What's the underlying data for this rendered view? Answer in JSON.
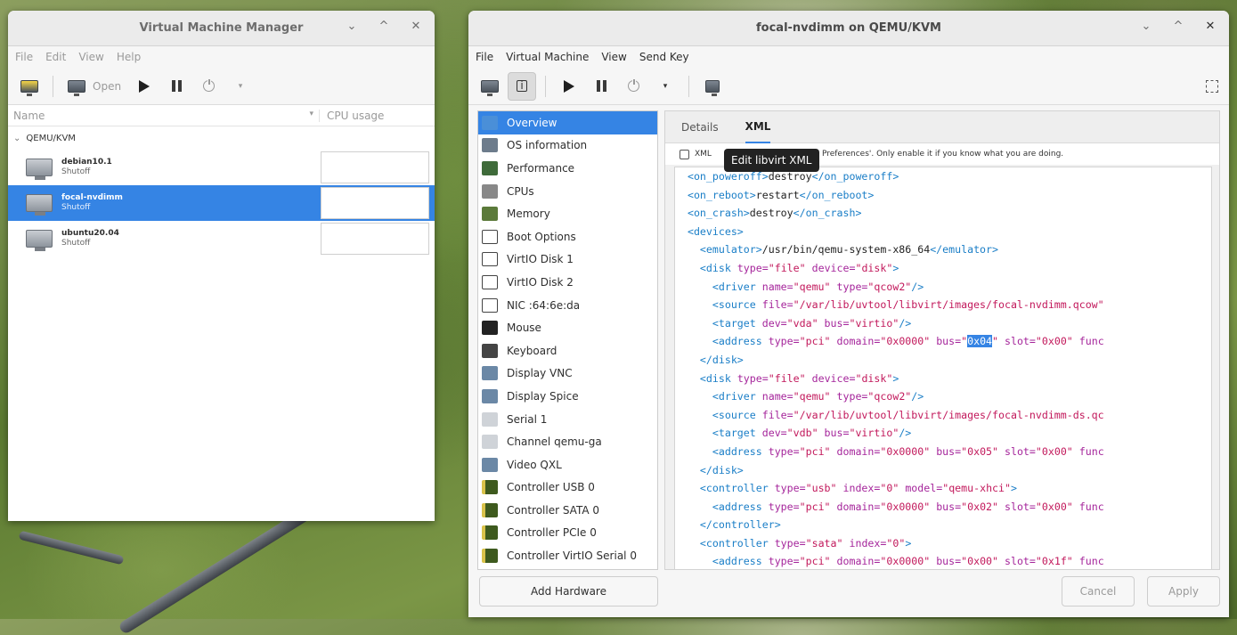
{
  "manager": {
    "title": "Virtual Machine Manager",
    "menu": [
      "File",
      "Edit",
      "View",
      "Help"
    ],
    "toolbar": {
      "open_label": "Open"
    },
    "columns": {
      "name": "Name",
      "cpu": "CPU usage"
    },
    "group": "QEMU/KVM",
    "vms": [
      {
        "name": "debian10.1",
        "state": "Shutoff"
      },
      {
        "name": "focal-nvdimm",
        "state": "Shutoff"
      },
      {
        "name": "ubuntu20.04",
        "state": "Shutoff"
      }
    ]
  },
  "vmwindow": {
    "title": "focal-nvdimm on QEMU/KVM",
    "menu": [
      "File",
      "Virtual Machine",
      "View",
      "Send Key"
    ],
    "sidebar": [
      {
        "label": "Overview",
        "icon": "overview-icon"
      },
      {
        "label": "OS information",
        "icon": "os-icon"
      },
      {
        "label": "Performance",
        "icon": "performance-icon"
      },
      {
        "label": "CPUs",
        "icon": "cpu-icon"
      },
      {
        "label": "Memory",
        "icon": "memory-icon"
      },
      {
        "label": "Boot Options",
        "icon": "boot-icon"
      },
      {
        "label": "VirtIO Disk 1",
        "icon": "disk-icon"
      },
      {
        "label": "VirtIO Disk 2",
        "icon": "disk-icon"
      },
      {
        "label": "NIC :64:6e:da",
        "icon": "nic-icon"
      },
      {
        "label": "Mouse",
        "icon": "mouse-icon"
      },
      {
        "label": "Keyboard",
        "icon": "keyboard-icon"
      },
      {
        "label": "Display VNC",
        "icon": "display-icon"
      },
      {
        "label": "Display Spice",
        "icon": "display-icon"
      },
      {
        "label": "Serial 1",
        "icon": "serial-icon"
      },
      {
        "label": "Channel qemu-ga",
        "icon": "channel-icon"
      },
      {
        "label": "Video QXL",
        "icon": "video-icon"
      },
      {
        "label": "Controller USB 0",
        "icon": "controller-icon"
      },
      {
        "label": "Controller SATA 0",
        "icon": "controller-icon"
      },
      {
        "label": "Controller PCIe 0",
        "icon": "controller-icon"
      },
      {
        "label": "Controller VirtIO Serial 0",
        "icon": "controller-icon"
      }
    ],
    "add_hardware": "Add Hardware",
    "tabs": {
      "details": "Details",
      "xml": "XML"
    },
    "xml_note": {
      "prefix": "XML",
      "suffix": "Preferences'. Only enable it if you know what you are doing."
    },
    "tooltip": "Edit libvirt XML",
    "xml_lines": [
      [
        [
          "tag",
          "<on_poweroff>"
        ],
        [
          "txt",
          "destroy"
        ],
        [
          "tag",
          "</on_poweroff>"
        ]
      ],
      [
        [
          "tag",
          "<on_reboot>"
        ],
        [
          "txt",
          "restart"
        ],
        [
          "tag",
          "</on_reboot>"
        ]
      ],
      [
        [
          "tag",
          "<on_crash>"
        ],
        [
          "txt",
          "destroy"
        ],
        [
          "tag",
          "</on_crash>"
        ]
      ],
      [
        [
          "tag",
          "<devices>"
        ]
      ],
      [
        [
          "tag",
          "  <emulator>"
        ],
        [
          "txt",
          "/usr/bin/qemu-system-x86_64"
        ],
        [
          "tag",
          "</emulator>"
        ]
      ],
      [
        [
          "tag",
          "  <disk"
        ],
        [
          "an",
          " type="
        ],
        [
          "av",
          "\"file\""
        ],
        [
          "an",
          " device="
        ],
        [
          "av",
          "\"disk\""
        ],
        [
          "tag",
          ">"
        ]
      ],
      [
        [
          "tag",
          "    <driver"
        ],
        [
          "an",
          " name="
        ],
        [
          "av",
          "\"qemu\""
        ],
        [
          "an",
          " type="
        ],
        [
          "av",
          "\"qcow2\""
        ],
        [
          "tag",
          "/>"
        ]
      ],
      [
        [
          "tag",
          "    <source"
        ],
        [
          "an",
          " file="
        ],
        [
          "av",
          "\"/var/lib/uvtool/libvirt/images/focal-nvdimm.qcow\""
        ]
      ],
      [
        [
          "tag",
          "    <target"
        ],
        [
          "an",
          " dev="
        ],
        [
          "av",
          "\"vda\""
        ],
        [
          "an",
          " bus="
        ],
        [
          "av",
          "\"virtio\""
        ],
        [
          "tag",
          "/>"
        ]
      ],
      [
        [
          "tag",
          "    <address"
        ],
        [
          "an",
          " type="
        ],
        [
          "av",
          "\"pci\""
        ],
        [
          "an",
          " domain="
        ],
        [
          "av",
          "\"0x0000\""
        ],
        [
          "an",
          " bus="
        ],
        [
          "av",
          "\""
        ],
        [
          "hl",
          "0x04"
        ],
        [
          "av",
          "\""
        ],
        [
          "an",
          " slot="
        ],
        [
          "av",
          "\"0x00\""
        ],
        [
          "an",
          " func"
        ]
      ],
      [
        [
          "tag",
          "  </disk>"
        ]
      ],
      [
        [
          "tag",
          "  <disk"
        ],
        [
          "an",
          " type="
        ],
        [
          "av",
          "\"file\""
        ],
        [
          "an",
          " device="
        ],
        [
          "av",
          "\"disk\""
        ],
        [
          "tag",
          ">"
        ]
      ],
      [
        [
          "tag",
          "    <driver"
        ],
        [
          "an",
          " name="
        ],
        [
          "av",
          "\"qemu\""
        ],
        [
          "an",
          " type="
        ],
        [
          "av",
          "\"qcow2\""
        ],
        [
          "tag",
          "/>"
        ]
      ],
      [
        [
          "tag",
          "    <source"
        ],
        [
          "an",
          " file="
        ],
        [
          "av",
          "\"/var/lib/uvtool/libvirt/images/focal-nvdimm-ds.qc"
        ]
      ],
      [
        [
          "tag",
          "    <target"
        ],
        [
          "an",
          " dev="
        ],
        [
          "av",
          "\"vdb\""
        ],
        [
          "an",
          " bus="
        ],
        [
          "av",
          "\"virtio\""
        ],
        [
          "tag",
          "/>"
        ]
      ],
      [
        [
          "tag",
          "    <address"
        ],
        [
          "an",
          " type="
        ],
        [
          "av",
          "\"pci\""
        ],
        [
          "an",
          " domain="
        ],
        [
          "av",
          "\"0x0000\""
        ],
        [
          "an",
          " bus="
        ],
        [
          "av",
          "\"0x05\""
        ],
        [
          "an",
          " slot="
        ],
        [
          "av",
          "\"0x00\""
        ],
        [
          "an",
          " func"
        ]
      ],
      [
        [
          "tag",
          "  </disk>"
        ]
      ],
      [
        [
          "tag",
          "  <controller"
        ],
        [
          "an",
          " type="
        ],
        [
          "av",
          "\"usb\""
        ],
        [
          "an",
          " index="
        ],
        [
          "av",
          "\"0\""
        ],
        [
          "an",
          " model="
        ],
        [
          "av",
          "\"qemu-xhci\""
        ],
        [
          "tag",
          ">"
        ]
      ],
      [
        [
          "tag",
          "    <address"
        ],
        [
          "an",
          " type="
        ],
        [
          "av",
          "\"pci\""
        ],
        [
          "an",
          " domain="
        ],
        [
          "av",
          "\"0x0000\""
        ],
        [
          "an",
          " bus="
        ],
        [
          "av",
          "\"0x02\""
        ],
        [
          "an",
          " slot="
        ],
        [
          "av",
          "\"0x00\""
        ],
        [
          "an",
          " func"
        ]
      ],
      [
        [
          "tag",
          "  </controller>"
        ]
      ],
      [
        [
          "tag",
          "  <controller"
        ],
        [
          "an",
          " type="
        ],
        [
          "av",
          "\"sata\""
        ],
        [
          "an",
          " index="
        ],
        [
          "av",
          "\"0\""
        ],
        [
          "tag",
          ">"
        ]
      ],
      [
        [
          "tag",
          "    <address"
        ],
        [
          "an",
          " type="
        ],
        [
          "av",
          "\"pci\""
        ],
        [
          "an",
          " domain="
        ],
        [
          "av",
          "\"0x0000\""
        ],
        [
          "an",
          " bus="
        ],
        [
          "av",
          "\"0x00\""
        ],
        [
          "an",
          " slot="
        ],
        [
          "av",
          "\"0x1f\""
        ],
        [
          "an",
          " func"
        ]
      ]
    ],
    "cancel": "Cancel",
    "apply": "Apply"
  }
}
